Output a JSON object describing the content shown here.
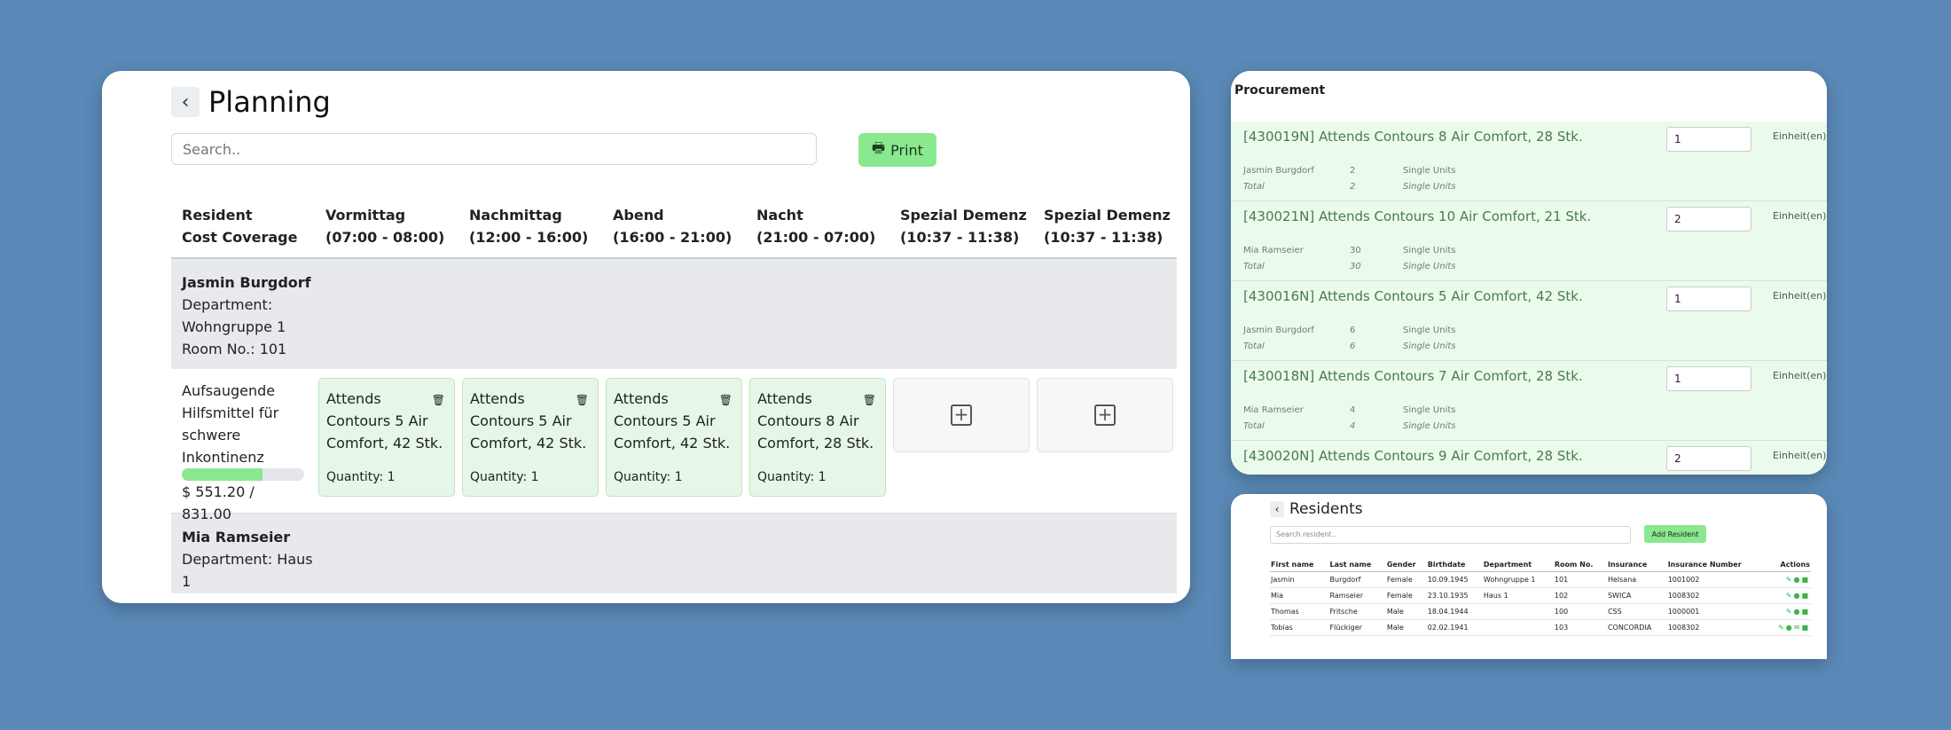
{
  "planning": {
    "title": "Planning",
    "back_icon": "chevron-left-icon",
    "search_placeholder": "Search..",
    "print_label": "Print",
    "columns": [
      {
        "line1": "Resident",
        "line2": "Cost Coverage"
      },
      {
        "line1": "Vormittag",
        "line2": "(07:00 - 08:00)"
      },
      {
        "line1": "Nachmittag",
        "line2": "(12:00 - 16:00)"
      },
      {
        "line1": "Abend",
        "line2": "(16:00 - 21:00)"
      },
      {
        "line1": "Nacht",
        "line2": "(21:00 - 07:00)"
      },
      {
        "line1": "Spezial Demenz",
        "line2": "(10:37 - 11:38)"
      },
      {
        "line1": "Spezial Demenz",
        "line2": "(10:37 - 11:38)"
      }
    ],
    "residents": [
      {
        "name": "Jasmin Burgdorf",
        "department_label": "Department:",
        "department": "Wohngruppe 1",
        "room": "Room No.: 101",
        "coverage_text": "Aufsaugende Hilfsmittel für schwere Inkontinenz",
        "coverage_amount": "$ 551.20 / 831.00",
        "coverage_fraction": 0.663,
        "slots": [
          {
            "product": "Attends Contours 5 Air Comfort, 42 Stk.",
            "quantity": "Quantity: 1"
          },
          {
            "product": "Attends Contours 5 Air Comfort, 42 Stk.",
            "quantity": "Quantity: 1"
          },
          {
            "product": "Attends Contours 5 Air Comfort, 42 Stk.",
            "quantity": "Quantity: 1"
          },
          {
            "product": "Attends Contours 8 Air Comfort, 28 Stk.",
            "quantity": "Quantity: 1"
          }
        ]
      },
      {
        "name": "Mia Ramseier",
        "department_label": "Department: Haus",
        "department": "1"
      }
    ]
  },
  "procurement": {
    "title": "Procurement",
    "items": [
      {
        "title": "[430019N] Attends Contours 8 Air Comfort, 28 Stk.",
        "qty": "1",
        "unit": "Einheit(en)",
        "resident": "Jasmin Burgdorf",
        "resident_count": "2",
        "total_label": "Total",
        "total_count": "2",
        "unit_type": "Single Units"
      },
      {
        "title": "[430021N] Attends Contours 10 Air Comfort, 21 Stk.",
        "qty": "2",
        "unit": "Einheit(en)",
        "resident": "Mia Ramseier",
        "resident_count": "30",
        "total_label": "Total",
        "total_count": "30",
        "unit_type": "Single Units"
      },
      {
        "title": "[430016N] Attends Contours 5 Air Comfort, 42 Stk.",
        "qty": "1",
        "unit": "Einheit(en)",
        "resident": "Jasmin Burgdorf",
        "resident_count": "6",
        "total_label": "Total",
        "total_count": "6",
        "unit_type": "Single Units"
      },
      {
        "title": "[430018N] Attends Contours 7 Air Comfort, 28 Stk.",
        "qty": "1",
        "unit": "Einheit(en)",
        "resident": "Mia Ramseier",
        "resident_count": "4",
        "total_label": "Total",
        "total_count": "4",
        "unit_type": "Single Units"
      },
      {
        "title": "[430020N] Attends Contours 9 Air Comfort, 28 Stk.",
        "qty": "2",
        "unit": "Einheit(en)"
      }
    ]
  },
  "residents_panel": {
    "title": "Residents",
    "search_placeholder": "Search resident..",
    "add_label": "Add Resident",
    "headers": [
      "First name",
      "Last name",
      "Gender",
      "Birthdate",
      "Department",
      "Room No.",
      "Insurance",
      "Insurance Number",
      "Actions"
    ],
    "rows": [
      [
        "Jasmin",
        "Burgdorf",
        "Female",
        "10.09.1945",
        "Wohngruppe 1",
        "101",
        "Helsana",
        "1001002"
      ],
      [
        "Mia",
        "Ramseier",
        "Female",
        "23.10.1935",
        "Haus 1",
        "102",
        "SWICA",
        "1008302"
      ],
      [
        "Thomas",
        "Fritsche",
        "Male",
        "18.04.1944",
        "",
        "100",
        "CSS",
        "1000001"
      ],
      [
        "Tobias",
        "Flückiger",
        "Male",
        "02.02.1941",
        "",
        "103",
        "CONCORDIA",
        "1008302"
      ]
    ]
  }
}
